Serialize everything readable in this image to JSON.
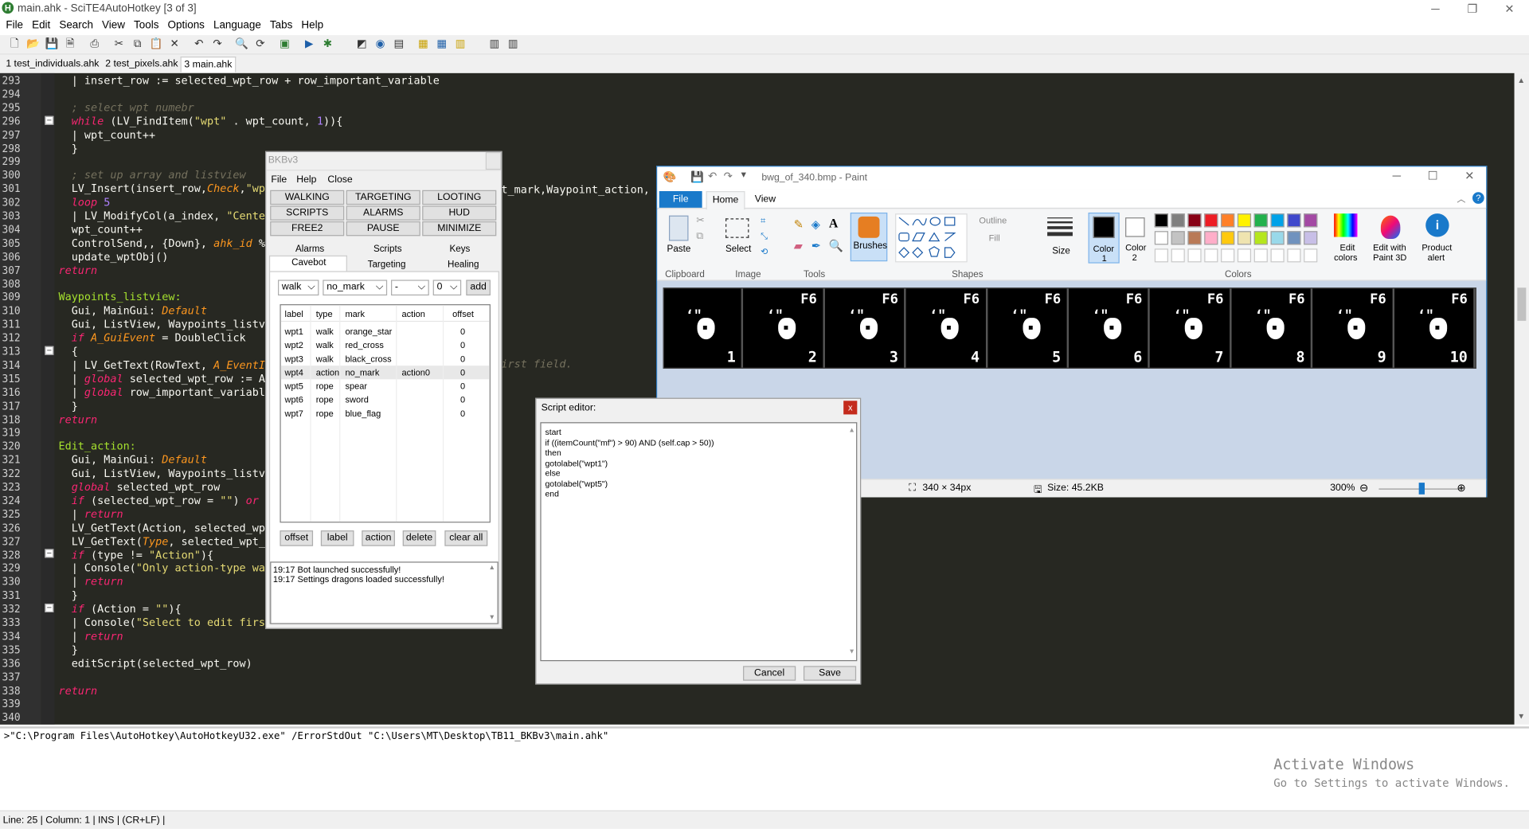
{
  "scite": {
    "title": "main.ahk - SciTE4AutoHotkey [3 of 3]",
    "menu": [
      "File",
      "Edit",
      "Search",
      "View",
      "Tools",
      "Options",
      "Language",
      "Tabs",
      "Help"
    ],
    "tabs": [
      "1 test_individuals.ahk",
      "2 test_pixels.ahk",
      "3 main.ahk"
    ],
    "lines": [
      {
        "n": "293",
        "code": "  | insert_row := selected_wpt_row + row_important_variable"
      },
      {
        "n": "294",
        "code": ""
      },
      {
        "n": "295",
        "code": "  ; select wpt numebr"
      },
      {
        "n": "296",
        "code": "  while (LV_FindItem(\"wpt\" . wpt_count, 1)){"
      },
      {
        "n": "297",
        "code": "  | wpt_count++"
      },
      {
        "n": "298",
        "code": "  }"
      },
      {
        "n": "299",
        "code": ""
      },
      {
        "n": "300",
        "code": "  ; set up array and listview"
      },
      {
        "n": "301",
        "code": "  LV_Insert(insert_row,Check,\"wp"
      },
      {
        "n": "302",
        "code": "  loop 5"
      },
      {
        "n": "303",
        "code": "  | LV_ModifyCol(a_index, \"Cente"
      },
      {
        "n": "304",
        "code": "  wpt_count++"
      },
      {
        "n": "305",
        "code": "  ControlSend,, {Down}, ahk_id %"
      },
      {
        "n": "306",
        "code": "  update_wptObj()"
      },
      {
        "n": "307",
        "code": "return"
      },
      {
        "n": "308",
        "code": ""
      },
      {
        "n": "309",
        "code": "Waypoints_listview:"
      },
      {
        "n": "310",
        "code": "  Gui, MainGui: Default"
      },
      {
        "n": "311",
        "code": "  Gui, ListView, Waypoints_listv"
      },
      {
        "n": "312",
        "code": "  if A_GuiEvent = DoubleClick"
      },
      {
        "n": "313",
        "code": "  {"
      },
      {
        "n": "314",
        "code": "  | LV_GetText(RowText, A_EventI"
      },
      {
        "n": "315",
        "code": "  | global selected_wpt_row := A"
      },
      {
        "n": "316",
        "code": "  | global row_important_variabl"
      },
      {
        "n": "317",
        "code": "  }"
      },
      {
        "n": "318",
        "code": "return"
      },
      {
        "n": "319",
        "code": ""
      },
      {
        "n": "320",
        "code": "Edit_action:"
      },
      {
        "n": "321",
        "code": "  Gui, MainGui: Default"
      },
      {
        "n": "322",
        "code": "  Gui, ListView, Waypoints_listv"
      },
      {
        "n": "323",
        "code": "  global selected_wpt_row"
      },
      {
        "n": "324",
        "code": "  if (selected_wpt_row = \"\") or"
      },
      {
        "n": "325",
        "code": "  | return"
      },
      {
        "n": "326",
        "code": "  LV_GetText(Action, selected_wp"
      },
      {
        "n": "327",
        "code": "  LV_GetText(Type, selected_wpt_"
      },
      {
        "n": "328",
        "code": "  if (type != \"Action\"){"
      },
      {
        "n": "329",
        "code": "  | Console(\"Only action-type wa"
      },
      {
        "n": "330",
        "code": "  | return"
      },
      {
        "n": "331",
        "code": "  }"
      },
      {
        "n": "332",
        "code": "  if (Action = \"\"){"
      },
      {
        "n": "333",
        "code": "  | Console(\"Select to edit firs"
      },
      {
        "n": "334",
        "code": "  | return"
      },
      {
        "n": "335",
        "code": "  }"
      },
      {
        "n": "336",
        "code": "  editScript(selected_wpt_row)"
      },
      {
        "n": "337",
        "code": ""
      },
      {
        "n": "338",
        "code": "return"
      },
      {
        "n": "339",
        "code": ""
      },
      {
        "n": "340",
        "code": ""
      }
    ],
    "line301_tail": "t_mark,Waypoint_action, W",
    "line314_tail": "irst field.",
    "output": ">\"C:\\Program Files\\AutoHotkey\\AutoHotkeyU32.exe\" /ErrorStdOut \"C:\\Users\\MT\\Desktop\\TB11_BKBv3\\main.ahk\"",
    "status": "Line: 25 | Column: 1 | INS | (CR+LF) |",
    "activate_title": "Activate Windows",
    "activate_sub": "Go to Settings to activate Windows."
  },
  "bkb": {
    "title": "BKBv3",
    "menu": [
      "File",
      "Help",
      "Close"
    ],
    "buttons_row1": [
      "WALKING",
      "TARGETING",
      "LOOTING"
    ],
    "buttons_row2": [
      "SCRIPTS",
      "ALARMS",
      "HUD"
    ],
    "buttons_row3": [
      "FREE2",
      "PAUSE",
      "MINIMIZE"
    ],
    "tabs_row1": [
      "Alarms",
      "Scripts",
      "Keys"
    ],
    "tabs_row2": [
      "Cavebot",
      "Targeting",
      "Healing"
    ],
    "dd_type": "walk",
    "dd_mark": "no_mark",
    "dd_dash": "-",
    "dd_num": "0",
    "add_label": "add",
    "columns": [
      "label",
      "type",
      "mark",
      "action",
      "offset"
    ],
    "rows": [
      [
        "wpt1",
        "walk",
        "orange_star",
        "",
        "0"
      ],
      [
        "wpt2",
        "walk",
        "red_cross",
        "",
        "0"
      ],
      [
        "wpt3",
        "walk",
        "black_cross",
        "",
        "0"
      ],
      [
        "wpt4",
        "action",
        "no_mark",
        "action0",
        "0"
      ],
      [
        "wpt5",
        "rope",
        "spear",
        "",
        "0"
      ],
      [
        "wpt6",
        "rope",
        "sword",
        "",
        "0"
      ],
      [
        "wpt7",
        "rope",
        "blue_flag",
        "",
        "0"
      ]
    ],
    "bottom_buttons": [
      "offset",
      "label",
      "action",
      "delete",
      "clear all"
    ],
    "log": [
      "19:17 Bot launched successfully!",
      "19:17 Settings dragons loaded successfully!"
    ]
  },
  "paint": {
    "title": "bwg_of_340.bmp - Paint",
    "tab_file": "File",
    "tab_home": "Home",
    "tab_view": "View",
    "paste": "Paste",
    "select": "Select",
    "brushes": "Brushes",
    "size": "Size",
    "color1": "Color\n1",
    "color1_a": "Color",
    "color1_b": "1",
    "color2_a": "Color",
    "color2_b": "2",
    "edit_colors_a": "Edit",
    "edit_colors_b": "colors",
    "paint3d_a": "Edit with",
    "paint3d_b": "Paint 3D",
    "product_a": "Product",
    "product_b": "alert",
    "outline": "Outline",
    "fill": "Fill",
    "groups": [
      "Clipboard",
      "Image",
      "Tools",
      "Shapes",
      "Colors"
    ],
    "frames": [
      "1",
      "2",
      "3",
      "4",
      "5",
      "6",
      "7",
      "8",
      "9",
      "10"
    ],
    "fkey": "F6",
    "dims": "340 × 34px",
    "size_label": "Size: 45.2KB",
    "zoom": "300%",
    "palette": [
      "#000000",
      "#7f7f7f",
      "#880015",
      "#ed1c24",
      "#ff7f27",
      "#fff200",
      "#22b14c",
      "#00a2e8",
      "#3f48cc",
      "#a349a4",
      "#ffffff",
      "#c3c3c3",
      "#b97a57",
      "#ffaec9",
      "#ffc90e",
      "#efe4b0",
      "#b5e61d",
      "#99d9ea",
      "#7092be",
      "#c8bfe7"
    ]
  },
  "script_editor": {
    "title": "Script editor:",
    "lines": [
      "start",
      "if ((itemCount(\"mf\") > 90) AND (self.cap > 50))",
      "then",
      "gotolabel(\"wpt1\")",
      "else",
      "gotolabel(\"wpt5\")",
      "end"
    ],
    "cancel": "Cancel",
    "save": "Save"
  }
}
